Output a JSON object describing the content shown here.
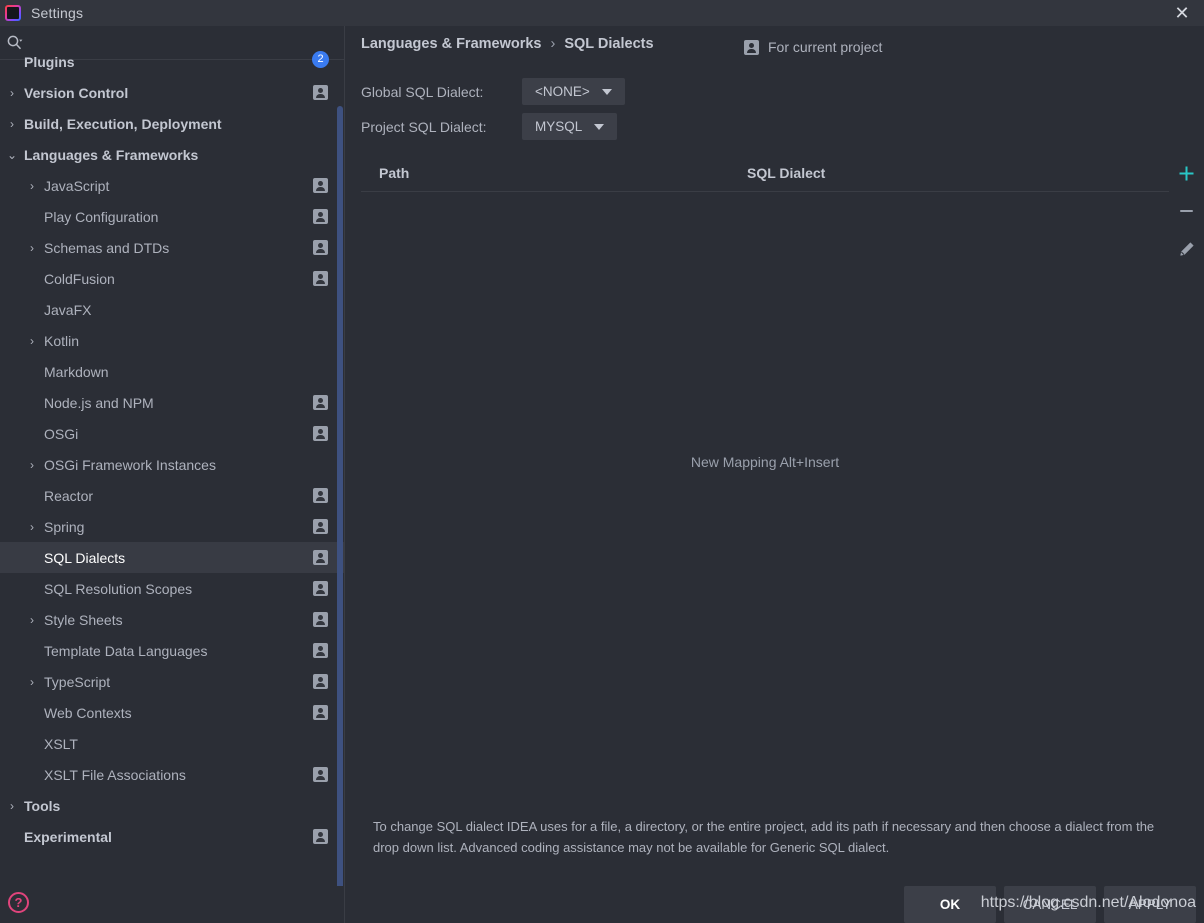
{
  "window": {
    "title": "Settings",
    "logo_icon": "intellij-idea-logo",
    "close_icon": "close-icon"
  },
  "sidebar": {
    "search": {
      "placeholder": "",
      "value": "",
      "icon": "search-icon"
    },
    "help_icon": "help-question-icon",
    "items": [
      {
        "label": "Plugins",
        "indent": 0,
        "arrow": "",
        "bold": true,
        "badge": "update",
        "badge_text": "2",
        "selected": false
      },
      {
        "label": "Version Control",
        "indent": 0,
        "arrow": "›",
        "bold": true,
        "badge": "person",
        "selected": false
      },
      {
        "label": "Build, Execution, Deployment",
        "indent": 0,
        "arrow": "›",
        "bold": true,
        "badge": "",
        "selected": false
      },
      {
        "label": "Languages & Frameworks",
        "indent": 0,
        "arrow": "⌄",
        "bold": true,
        "badge": "",
        "selected": false
      },
      {
        "label": "JavaScript",
        "indent": 1,
        "arrow": "›",
        "bold": false,
        "badge": "person",
        "selected": false
      },
      {
        "label": "Play Configuration",
        "indent": 1,
        "arrow": "",
        "bold": false,
        "badge": "person",
        "selected": false
      },
      {
        "label": "Schemas and DTDs",
        "indent": 1,
        "arrow": "›",
        "bold": false,
        "badge": "person",
        "selected": false
      },
      {
        "label": "ColdFusion",
        "indent": 1,
        "arrow": "",
        "bold": false,
        "badge": "person",
        "selected": false
      },
      {
        "label": "JavaFX",
        "indent": 1,
        "arrow": "",
        "bold": false,
        "badge": "",
        "selected": false
      },
      {
        "label": "Kotlin",
        "indent": 1,
        "arrow": "›",
        "bold": false,
        "badge": "",
        "selected": false
      },
      {
        "label": "Markdown",
        "indent": 1,
        "arrow": "",
        "bold": false,
        "badge": "",
        "selected": false
      },
      {
        "label": "Node.js and NPM",
        "indent": 1,
        "arrow": "",
        "bold": false,
        "badge": "person",
        "selected": false
      },
      {
        "label": "OSGi",
        "indent": 1,
        "arrow": "",
        "bold": false,
        "badge": "person",
        "selected": false
      },
      {
        "label": "OSGi Framework Instances",
        "indent": 1,
        "arrow": "›",
        "bold": false,
        "badge": "",
        "selected": false
      },
      {
        "label": "Reactor",
        "indent": 1,
        "arrow": "",
        "bold": false,
        "badge": "person",
        "selected": false
      },
      {
        "label": "Spring",
        "indent": 1,
        "arrow": "›",
        "bold": false,
        "badge": "person",
        "selected": false
      },
      {
        "label": "SQL Dialects",
        "indent": 1,
        "arrow": "",
        "bold": false,
        "badge": "person",
        "selected": true
      },
      {
        "label": "SQL Resolution Scopes",
        "indent": 1,
        "arrow": "",
        "bold": false,
        "badge": "person",
        "selected": false
      },
      {
        "label": "Style Sheets",
        "indent": 1,
        "arrow": "›",
        "bold": false,
        "badge": "person",
        "selected": false
      },
      {
        "label": "Template Data Languages",
        "indent": 1,
        "arrow": "",
        "bold": false,
        "badge": "person",
        "selected": false
      },
      {
        "label": "TypeScript",
        "indent": 1,
        "arrow": "›",
        "bold": false,
        "badge": "person",
        "selected": false
      },
      {
        "label": "Web Contexts",
        "indent": 1,
        "arrow": "",
        "bold": false,
        "badge": "person",
        "selected": false
      },
      {
        "label": "XSLT",
        "indent": 1,
        "arrow": "",
        "bold": false,
        "badge": "",
        "selected": false
      },
      {
        "label": "XSLT File Associations",
        "indent": 1,
        "arrow": "",
        "bold": false,
        "badge": "person",
        "selected": false
      },
      {
        "label": "Tools",
        "indent": 0,
        "arrow": "›",
        "bold": true,
        "badge": "",
        "selected": false
      },
      {
        "label": "Experimental",
        "indent": 0,
        "arrow": "",
        "bold": true,
        "badge": "person",
        "selected": false
      }
    ]
  },
  "main": {
    "breadcrumb": {
      "parent": "Languages & Frameworks",
      "separator": "›",
      "current": "SQL Dialects"
    },
    "for_current_project": {
      "label": "For current project",
      "icon": "project-person-icon"
    },
    "fields": [
      {
        "label": "Global SQL Dialect:",
        "value": "<NONE>",
        "icon": "chevron-down-icon"
      },
      {
        "label": "Project SQL Dialect:",
        "value": "MYSQL",
        "icon": "chevron-down-icon"
      }
    ],
    "table": {
      "columns": [
        "Path",
        "SQL Dialect"
      ],
      "rows": [],
      "empty_text": "New Mapping Alt+Insert"
    },
    "actions": [
      {
        "name": "add-mapping-button",
        "icon": "plus-icon",
        "color": "#29c6c6"
      },
      {
        "name": "remove-mapping-button",
        "icon": "minus-icon",
        "color": "#9aa0ac"
      },
      {
        "name": "edit-mapping-button",
        "icon": "pencil-icon",
        "color": "#9aa0ac"
      }
    ],
    "hint": "To change SQL dialect IDEA uses for a file, a directory, or the entire project, add its path if necessary and then choose a dialect from the drop down list. Advanced coding assistance may not be available for Generic SQL dialect."
  },
  "footer": {
    "buttons": [
      {
        "label": "OK",
        "primary": true
      },
      {
        "label": "CANCEL",
        "primary": false
      },
      {
        "label": "APPLY",
        "primary": false
      }
    ]
  },
  "watermark": {
    "text": "https://blog.csdn.net/Alodonoa"
  },
  "colors": {
    "background": "#2b2e36",
    "titlebar": "#33363e",
    "control": "#3c3f48",
    "selection": "#383b44",
    "accent_add": "#29c6c6",
    "accent_badge": "#3a7bf0",
    "accent_help": "#e0447c",
    "scrollbar": "#3e5180",
    "text": "#aeb2bd",
    "text_strong": "#c3c7d1"
  }
}
